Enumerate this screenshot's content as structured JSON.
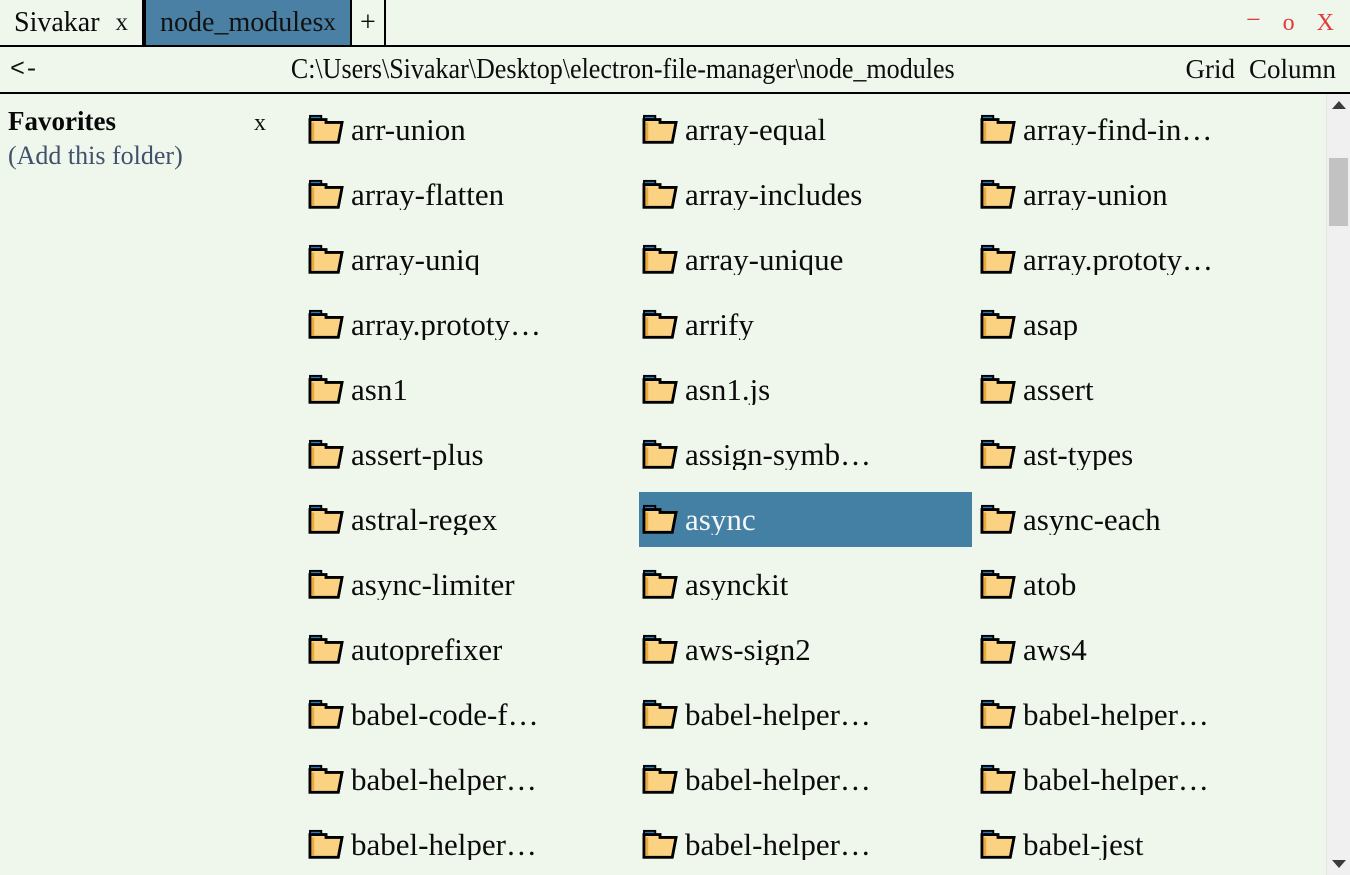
{
  "window": {
    "controls": [
      {
        "name": "minimize-button",
        "label": "−"
      },
      {
        "name": "maximize-button",
        "label": "o"
      },
      {
        "name": "close-button",
        "label": "X"
      }
    ],
    "control_color": "#e03b3b"
  },
  "tabs": {
    "items": [
      {
        "label": "Sivakar",
        "close_label": "x",
        "active": false
      },
      {
        "label": "node_modules",
        "close_label": "x",
        "active": true
      }
    ],
    "add_label": "+",
    "active_color": "#4a80a4"
  },
  "addressbar": {
    "back_label": "<-",
    "path": "C:\\Users\\Sivakar\\Desktop\\electron-file-manager\\node_modules",
    "view_modes": [
      {
        "label": "Grid",
        "active": true
      },
      {
        "label": "Column",
        "active": false
      }
    ]
  },
  "sidebar": {
    "favorites_title": "Favorites",
    "favorites_close": "x",
    "add_folder_label": "(Add this folder)",
    "add_folder_color": "#41506b"
  },
  "files": {
    "selection_color": "#4480a4",
    "icon_name": "folder-icon",
    "items": [
      {
        "label": "arr-union",
        "selected": false
      },
      {
        "label": "array-equal",
        "selected": false
      },
      {
        "label": "array-find-in…",
        "selected": false
      },
      {
        "label": "array-flatten",
        "selected": false
      },
      {
        "label": "array-includes",
        "selected": false
      },
      {
        "label": "array-union",
        "selected": false
      },
      {
        "label": "array-uniq",
        "selected": false
      },
      {
        "label": "array-unique",
        "selected": false
      },
      {
        "label": "array.prototy…",
        "selected": false
      },
      {
        "label": "array.prototy…",
        "selected": false
      },
      {
        "label": "arrify",
        "selected": false
      },
      {
        "label": "asap",
        "selected": false
      },
      {
        "label": "asn1",
        "selected": false
      },
      {
        "label": "asn1.js",
        "selected": false
      },
      {
        "label": "assert",
        "selected": false
      },
      {
        "label": "assert-plus",
        "selected": false
      },
      {
        "label": "assign-symb…",
        "selected": false
      },
      {
        "label": "ast-types",
        "selected": false
      },
      {
        "label": "astral-regex",
        "selected": false
      },
      {
        "label": "async",
        "selected": true
      },
      {
        "label": "async-each",
        "selected": false
      },
      {
        "label": "async-limiter",
        "selected": false
      },
      {
        "label": "asynckit",
        "selected": false
      },
      {
        "label": "atob",
        "selected": false
      },
      {
        "label": "autoprefixer",
        "selected": false
      },
      {
        "label": "aws-sign2",
        "selected": false
      },
      {
        "label": "aws4",
        "selected": false
      },
      {
        "label": "babel-code-f…",
        "selected": false
      },
      {
        "label": "babel-helper…",
        "selected": false
      },
      {
        "label": "babel-helper…",
        "selected": false
      },
      {
        "label": "babel-helper…",
        "selected": false
      },
      {
        "label": "babel-helper…",
        "selected": false
      },
      {
        "label": "babel-helper…",
        "selected": false
      },
      {
        "label": "babel-helper…",
        "selected": false
      },
      {
        "label": "babel-helper…",
        "selected": false
      },
      {
        "label": "babel-jest",
        "selected": false
      }
    ]
  },
  "scrollbar": {
    "up_arrow_name": "scroll-up-arrow",
    "down_arrow_name": "scroll-down-arrow"
  }
}
